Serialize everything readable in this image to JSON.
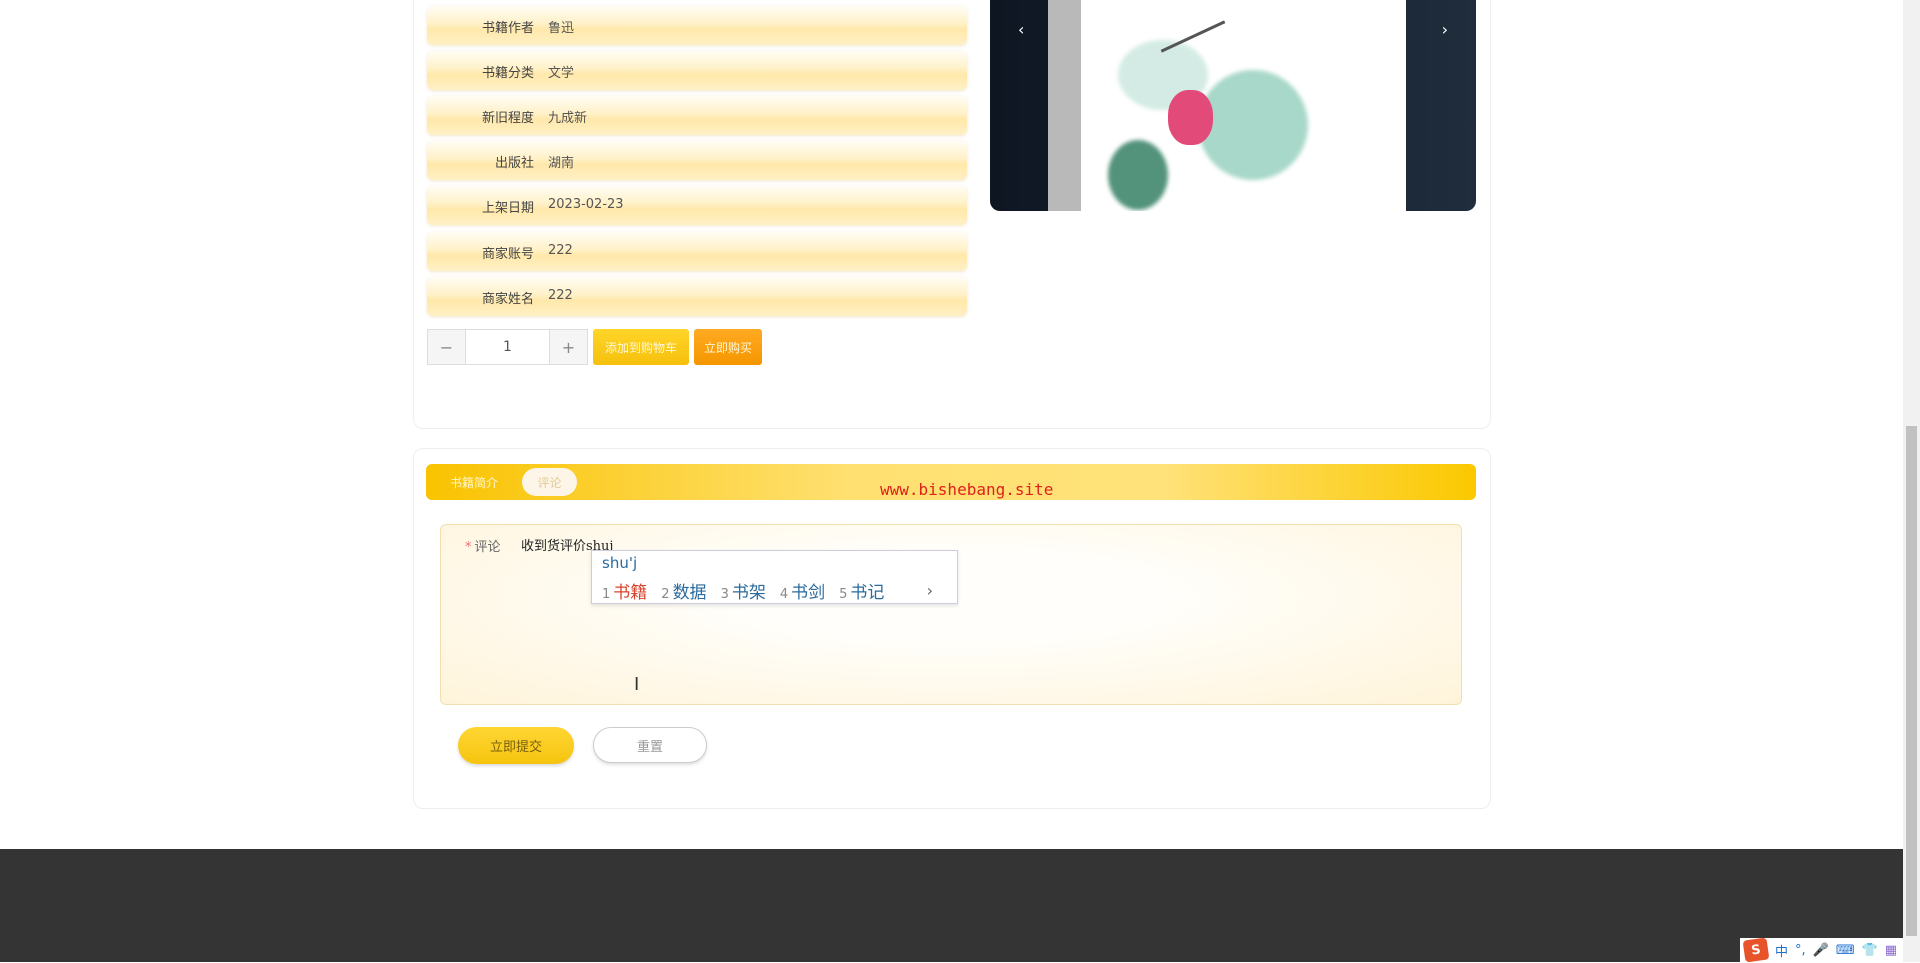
{
  "details": [
    {
      "label": "书籍作者",
      "value": "鲁迅"
    },
    {
      "label": "书籍分类",
      "value": "文学"
    },
    {
      "label": "新旧程度",
      "value": "九成新"
    },
    {
      "label": "出版社",
      "value": "湖南"
    },
    {
      "label": "上架日期",
      "value": "2023-02-23"
    },
    {
      "label": "商家账号",
      "value": "222"
    },
    {
      "label": "商家姓名",
      "value": "222"
    }
  ],
  "quantity": {
    "minus": "−",
    "value": "1",
    "plus": "+"
  },
  "actions": {
    "add_cart": "添加到购物车",
    "buy_now": "立即购买"
  },
  "carousel": {
    "prev": "‹",
    "next": "›"
  },
  "tabs": [
    {
      "label": "书籍简介"
    },
    {
      "label": "评论"
    }
  ],
  "watermark": "www.bishebang.site",
  "form": {
    "label": "评论",
    "required_mark": "*",
    "value": "收到货评价shuj"
  },
  "ime": {
    "pinyin": "shu'j",
    "candidates": [
      {
        "n": "1",
        "text": "书籍"
      },
      {
        "n": "2",
        "text": "数据"
      },
      {
        "n": "3",
        "text": "书架"
      },
      {
        "n": "4",
        "text": "书剑"
      },
      {
        "n": "5",
        "text": "书记"
      }
    ],
    "next": "›"
  },
  "buttons": {
    "submit": "立即提交",
    "reset": "重置"
  },
  "tray": {
    "ime_logo": "S",
    "lang": "中",
    "punct": "°,",
    "mic": "🎤",
    "keyboard": "⌨",
    "skin": "👕",
    "apps": "▦"
  }
}
